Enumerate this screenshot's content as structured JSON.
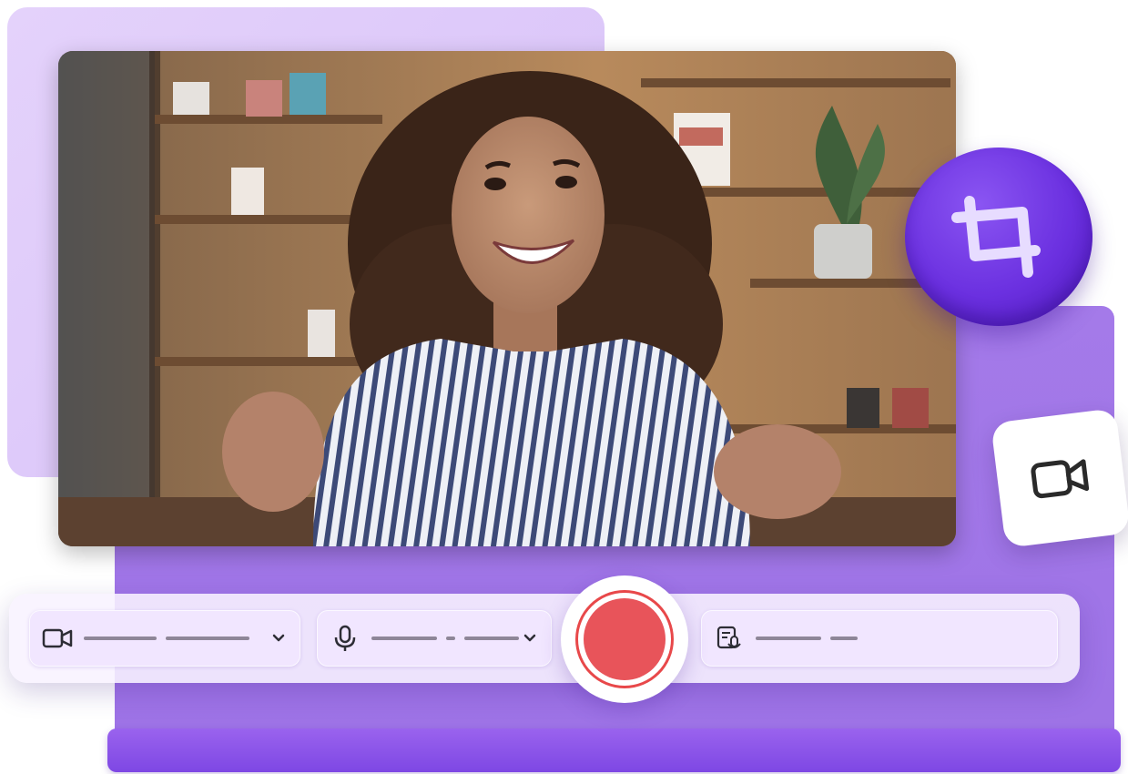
{
  "colors": {
    "accent": "#9d72e6",
    "accent_dark": "#6b30e0",
    "record": "#e8545a",
    "panel_light": "#e0ccfa",
    "toolbar_bg": "#f6f0ff"
  },
  "icons": {
    "crop": "crop-icon",
    "video_badge": "video-camera-icon",
    "camera_select": "camera-icon",
    "mic_select": "microphone-icon",
    "script": "script-document-icon",
    "chevron": "chevron-down-icon"
  },
  "toolbar": {
    "camera_select": {
      "value": "",
      "has_dropdown": true
    },
    "mic_select": {
      "value": "",
      "has_dropdown": true
    },
    "record_button": {
      "state": "idle"
    },
    "script_field": {
      "value": ""
    }
  },
  "preview": {
    "kind": "webcam-video-preview"
  }
}
